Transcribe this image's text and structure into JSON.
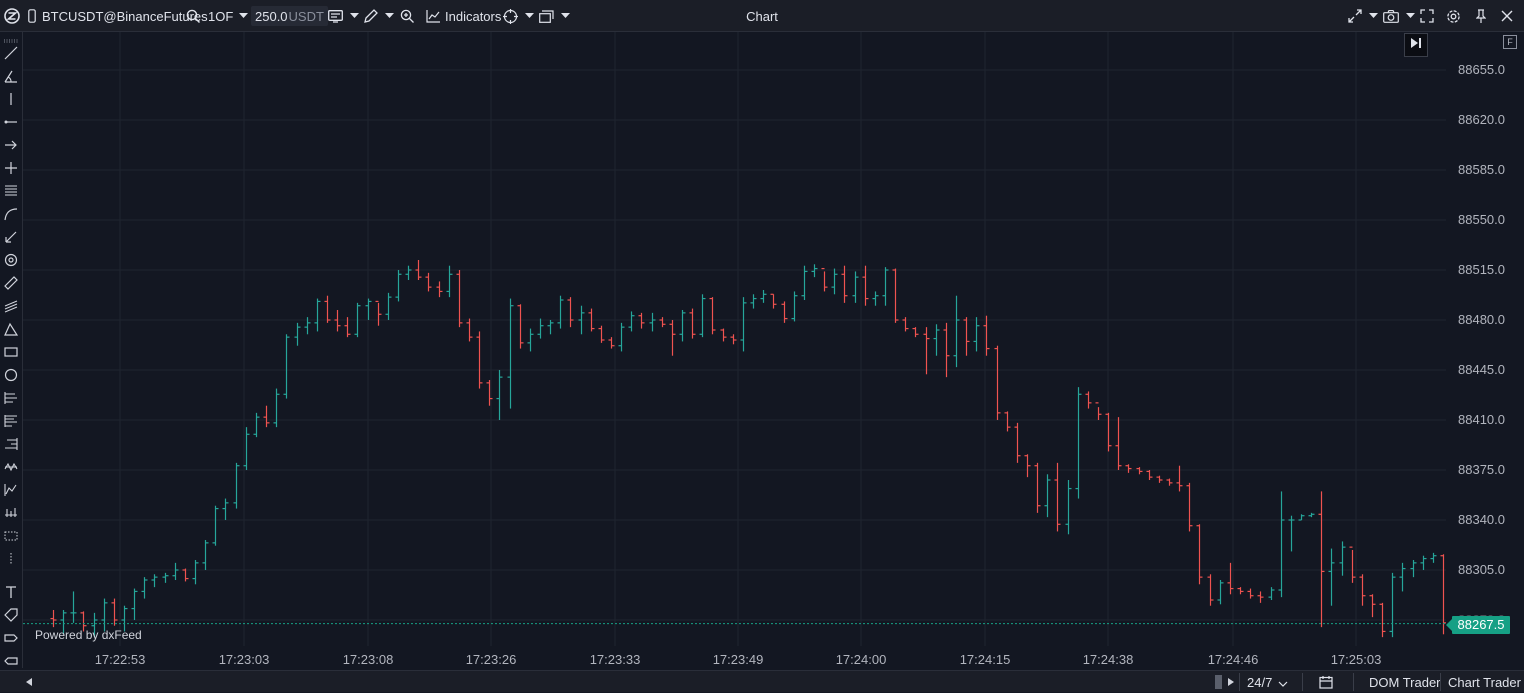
{
  "toolbar": {
    "symbol": "BTCUSDT@BinanceFutures",
    "timeframe": "1OF",
    "quantity_value": "250.0",
    "quantity_unit": "USDT",
    "indicators_label": "Indicators",
    "window_title": "Chart"
  },
  "icons": [
    "app-logo-icon",
    "mobile-icon",
    "search-icon",
    "chevron-down-icon",
    "chart-type-icon",
    "pencil-icon",
    "zoom-icon",
    "indicators-icon",
    "crosshair-icon",
    "templates-icon",
    "link-icon",
    "camera-icon",
    "fullscreen-icon",
    "settings-icon",
    "pin-icon",
    "close-icon"
  ],
  "side_right_button": "F",
  "y_axis": {
    "labels": [
      "88655.0",
      "88620.0",
      "88585.0",
      "88550.0",
      "88515.0",
      "88480.0",
      "88445.0",
      "88410.0",
      "88375.0",
      "88340.0",
      "88305.0",
      "88270.0"
    ],
    "current_price": "88267.5"
  },
  "x_axis": {
    "labels": [
      "17:22:53",
      "17:23:03",
      "17:23:08",
      "17:23:26",
      "17:23:33",
      "17:23:49",
      "17:24:00",
      "17:24:15",
      "17:24:38",
      "17:24:46",
      "17:25:03"
    ]
  },
  "watermark": "Powered by dxFeed",
  "bottom": {
    "session": "24/7",
    "dom_trader": "DOM Trader",
    "chart_trader": "Chart Trader"
  },
  "colors": {
    "up": "#26a69a",
    "down": "#ef5350",
    "background": "#131722",
    "grid": "#1f2430",
    "price_tag": "#16a085"
  },
  "chart_data": {
    "type": "ohlc",
    "y_range": [
      88250,
      88680
    ],
    "bars": [
      [
        88271,
        88277,
        88265,
        88270
      ],
      [
        88270,
        88277,
        88260,
        88275
      ],
      [
        88275,
        88290,
        88268,
        88275
      ],
      [
        88275,
        88276,
        88262,
        88266
      ],
      [
        88266,
        88275,
        88258,
        88270
      ],
      [
        88270,
        88285,
        88262,
        88282
      ],
      [
        88282,
        88285,
        88266,
        88270
      ],
      [
        88270,
        88280,
        88262,
        88278
      ],
      [
        88278,
        88292,
        88270,
        88290
      ],
      [
        88290,
        88300,
        88285,
        88298
      ],
      [
        88298,
        88302,
        88293,
        88300
      ],
      [
        88300,
        88303,
        88296,
        88301
      ],
      [
        88301,
        88310,
        88298,
        88305
      ],
      [
        88305,
        88306,
        88297,
        88299
      ],
      [
        88299,
        88312,
        88295,
        88310
      ],
      [
        88310,
        88326,
        88305,
        88324
      ],
      [
        88324,
        88350,
        88322,
        88348
      ],
      [
        88348,
        88355,
        88340,
        88352
      ],
      [
        88352,
        88380,
        88348,
        88378
      ],
      [
        88378,
        88405,
        88375,
        88400
      ],
      [
        88400,
        88415,
        88398,
        88412
      ],
      [
        88412,
        88420,
        88405,
        88408
      ],
      [
        88408,
        88432,
        88405,
        88428
      ],
      [
        88428,
        88470,
        88425,
        88468
      ],
      [
        88468,
        88478,
        88462,
        88475
      ],
      [
        88475,
        88482,
        88470,
        88478
      ],
      [
        88478,
        88495,
        88472,
        88493
      ],
      [
        88493,
        88497,
        88478,
        88480
      ],
      [
        88480,
        88487,
        88472,
        88476
      ],
      [
        88476,
        88482,
        88468,
        88470
      ],
      [
        88470,
        88492,
        88468,
        88490
      ],
      [
        88490,
        88495,
        88480,
        88493
      ],
      [
        88493,
        88492,
        88476,
        88484
      ],
      [
        88484,
        88499,
        88480,
        88496
      ],
      [
        88496,
        88515,
        88493,
        88512
      ],
      [
        88512,
        88518,
        88508,
        88515
      ],
      [
        88515,
        88522,
        88508,
        88510
      ],
      [
        88510,
        88513,
        88500,
        88503
      ],
      [
        88503,
        88507,
        88496,
        88500
      ],
      [
        88500,
        88518,
        88496,
        88512
      ],
      [
        88512,
        88515,
        88475,
        88478
      ],
      [
        88478,
        88481,
        88465,
        88468
      ],
      [
        88468,
        88472,
        88432,
        88436
      ],
      [
        88436,
        88438,
        88420,
        88425
      ],
      [
        88425,
        88445,
        88410,
        88440
      ],
      [
        88440,
        88495,
        88418,
        88490
      ],
      [
        88490,
        88491,
        88460,
        88464
      ],
      [
        88464,
        88474,
        88458,
        88470
      ],
      [
        88470,
        88481,
        88467,
        88476
      ],
      [
        88476,
        88480,
        88470,
        88478
      ],
      [
        88478,
        88497,
        88474,
        88494
      ],
      [
        88494,
        88496,
        88475,
        88480
      ],
      [
        88480,
        88490,
        88470,
        88485
      ],
      [
        88485,
        88488,
        88472,
        88474
      ],
      [
        88474,
        88476,
        88464,
        88466
      ],
      [
        88466,
        88468,
        88460,
        88462
      ],
      [
        88462,
        88478,
        88458,
        88475
      ],
      [
        88475,
        88486,
        88472,
        88483
      ],
      [
        88483,
        88485,
        88474,
        88478
      ],
      [
        88478,
        88485,
        88472,
        88480
      ],
      [
        88480,
        88482,
        88475,
        88477
      ],
      [
        88477,
        88480,
        88455,
        88470
      ],
      [
        88470,
        88487,
        88465,
        88485
      ],
      [
        88485,
        88488,
        88467,
        88470
      ],
      [
        88470,
        88498,
        88468,
        88495
      ],
      [
        88495,
        88496,
        88470,
        88473
      ],
      [
        88473,
        88474,
        88465,
        88468
      ],
      [
        88468,
        88470,
        88463,
        88466
      ],
      [
        88466,
        88496,
        88458,
        88492
      ],
      [
        88492,
        88498,
        88488,
        88495
      ],
      [
        88495,
        88501,
        88492,
        88498
      ],
      [
        88498,
        88498,
        88488,
        88491
      ],
      [
        88491,
        88493,
        88478,
        88481
      ],
      [
        88481,
        88500,
        88479,
        88497
      ],
      [
        88497,
        88518,
        88494,
        88514
      ],
      [
        88514,
        88519,
        88510,
        88516
      ],
      [
        88516,
        88514,
        88500,
        88503
      ],
      [
        88503,
        88516,
        88498,
        88512
      ],
      [
        88512,
        88518,
        88492,
        88497
      ],
      [
        88497,
        88514,
        88492,
        88510
      ],
      [
        88510,
        88518,
        88490,
        88495
      ],
      [
        88495,
        88500,
        88490,
        88497
      ],
      [
        88497,
        88517,
        88490,
        88515
      ],
      [
        88515,
        88516,
        88478,
        88480
      ],
      [
        88480,
        88482,
        88472,
        88474
      ],
      [
        88474,
        88475,
        88468,
        88470
      ],
      [
        88470,
        88475,
        88442,
        88467
      ],
      [
        88467,
        88477,
        88455,
        88473
      ],
      [
        88473,
        88478,
        88440,
        88455
      ],
      [
        88455,
        88497,
        88447,
        88480
      ],
      [
        88480,
        88482,
        88455,
        88465
      ],
      [
        88465,
        88482,
        88458,
        88476
      ],
      [
        88476,
        88483,
        88455,
        88460
      ],
      [
        88460,
        88462,
        88410,
        88415
      ],
      [
        88415,
        88416,
        88402,
        88405
      ],
      [
        88405,
        88408,
        88380,
        88385
      ],
      [
        88385,
        88386,
        88370,
        88378
      ],
      [
        88378,
        88380,
        88345,
        88350
      ],
      [
        88350,
        88372,
        88342,
        88368
      ],
      [
        88368,
        88380,
        88332,
        88337
      ],
      [
        88337,
        88368,
        88330,
        88362
      ],
      [
        88362,
        88433,
        88355,
        88428
      ],
      [
        88428,
        88430,
        88418,
        88422
      ],
      [
        88422,
        88419,
        88410,
        88414
      ],
      [
        88414,
        88415,
        88388,
        88392
      ],
      [
        88392,
        88412,
        88375,
        88378
      ],
      [
        88378,
        88379,
        88373,
        88376
      ],
      [
        88376,
        88377,
        88372,
        88374
      ],
      [
        88374,
        88375,
        88368,
        88370
      ],
      [
        88370,
        88371,
        88366,
        88368
      ],
      [
        88368,
        88369,
        88364,
        88366
      ],
      [
        88366,
        88378,
        88360,
        88364
      ],
      [
        88364,
        88366,
        88332,
        88336
      ],
      [
        88336,
        88337,
        88295,
        88300
      ],
      [
        88300,
        88302,
        88280,
        88284
      ],
      [
        88284,
        88298,
        88281,
        88296
      ],
      [
        88296,
        88310,
        88288,
        88292
      ],
      [
        88292,
        88293,
        88288,
        88290
      ],
      [
        88290,
        88292,
        88285,
        88287
      ],
      [
        88287,
        88290,
        88282,
        88286
      ],
      [
        88286,
        88293,
        88284,
        88291
      ],
      [
        88291,
        88360,
        88286,
        88340
      ],
      [
        88340,
        88343,
        88318,
        88340
      ],
      [
        88340,
        88344,
        88340,
        88343
      ],
      [
        88343,
        88345,
        88342,
        88344
      ],
      [
        88344,
        88360,
        88265,
        88304
      ],
      [
        88304,
        88320,
        88280,
        88310
      ],
      [
        88310,
        88325,
        88301,
        88321
      ],
      [
        88321,
        88319,
        88296,
        88300
      ],
      [
        88300,
        88302,
        88280,
        88287
      ],
      [
        88287,
        88288,
        88272,
        88281
      ],
      [
        88281,
        88282,
        88258,
        88262
      ],
      [
        88262,
        88303,
        88258,
        88300
      ],
      [
        88300,
        88310,
        88290,
        88306
      ],
      [
        88306,
        88312,
        88300,
        88310
      ],
      [
        88310,
        88315,
        88305,
        88313
      ],
      [
        88313,
        88317,
        88310,
        88315
      ],
      [
        88315,
        88316,
        88260,
        88268
      ]
    ]
  }
}
